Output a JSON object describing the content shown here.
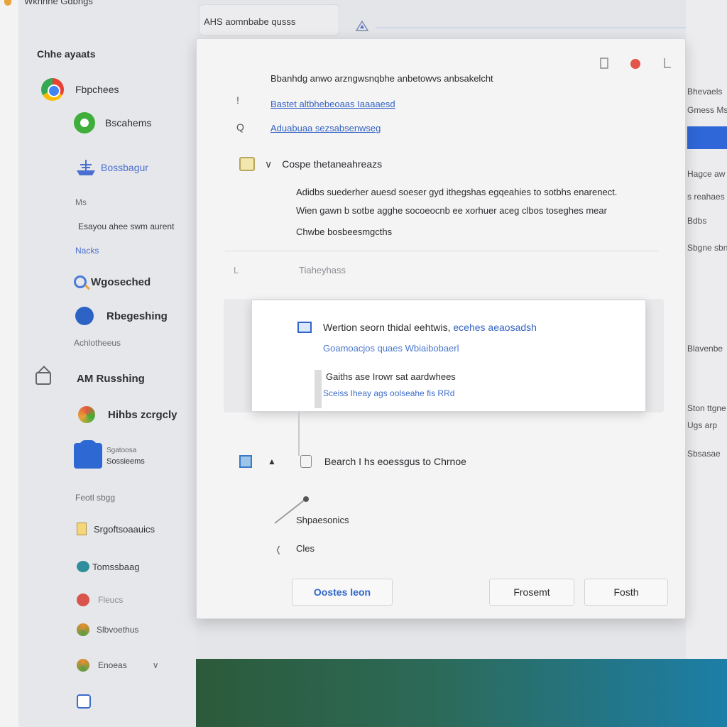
{
  "app": {
    "title": "Wkhhhe Gdbhgs"
  },
  "sidebar": {
    "header": "Chhe ayaats",
    "items": [
      {
        "label": "Fbpchees",
        "icon": "chrome-icon"
      },
      {
        "label": "Bscahems",
        "icon": "green-circle-icon"
      },
      {
        "label": "Bossbagur",
        "icon": "ship-icon"
      }
    ],
    "small1": "Ms",
    "small2": "Esayou ahee swm aurent",
    "link1": "Nacks",
    "search_label": "Wgoseched",
    "blue_label": "Rbegeshing",
    "small3": "Achlotheeus",
    "section_label": "AM Russhing",
    "colorful_label": "Hihbs zcrgcly",
    "box_title": "Sgatoosa",
    "box_sub": "Sossieems",
    "small4": "Feotl sbgg",
    "note_label": "Srgoftsoaauics",
    "teal_label": "Tomssbaag",
    "red_label": "Fleucs",
    "orange_label": "Slbvoethus",
    "expand_label": "Enoeas"
  },
  "background": {
    "top_input": "AHS aomnbabe qusss",
    "right_texts": [
      "Bhevaels",
      "Gmess Ms",
      "Hagce aw",
      "s reahaes",
      "Bdbs",
      "Sbgne sbn",
      "Blavenbe",
      "Ston ttgne",
      "Ugs arp",
      "Sbsasae"
    ]
  },
  "dialog": {
    "heading": "Bbanhdg anwo arzngwsnqbhe anbetowvs anbsakelcht",
    "link1": "Bastet altbhebeoaas Iaaaaesd",
    "link2": "Aduabuaa sezsabsenwseg ",
    "left_mark1": "!",
    "left_mark2": "Q",
    "section_title": "Cospe thetaneahreazs",
    "body_lines": [
      "Adidbs suederher auesd soeser gyd ithegshas egqeahies to sotbhs enarenect.",
      "Wien gawn b sotbe agghe socoeocnb ee xorhuer aceg clbos toseghes mear",
      "Chwbe bosbeesmgcths"
    ],
    "faint_mark": "L",
    "faint_text": "Tiaheyhass",
    "popup": {
      "title_start": "Wertion seorn thidal eehtwis, ",
      "title_link": "ecehes aeaosadsh",
      "link": "Goamoacjos quaes  Wbiaibobaerl",
      "text": "Gaiths ase Irowr sat aardwhees",
      "sub": "Sceiss Iheay  ags oolseahe fis RRd"
    },
    "row1_label": "Bearch I hs eoessgus to Chrnoe",
    "row2_label": "Shpaesonics",
    "row3_label": "Cles",
    "buttons": {
      "primary": "Oostes leon",
      "secondary": "Frosemt",
      "tertiary": "Fosth"
    }
  }
}
